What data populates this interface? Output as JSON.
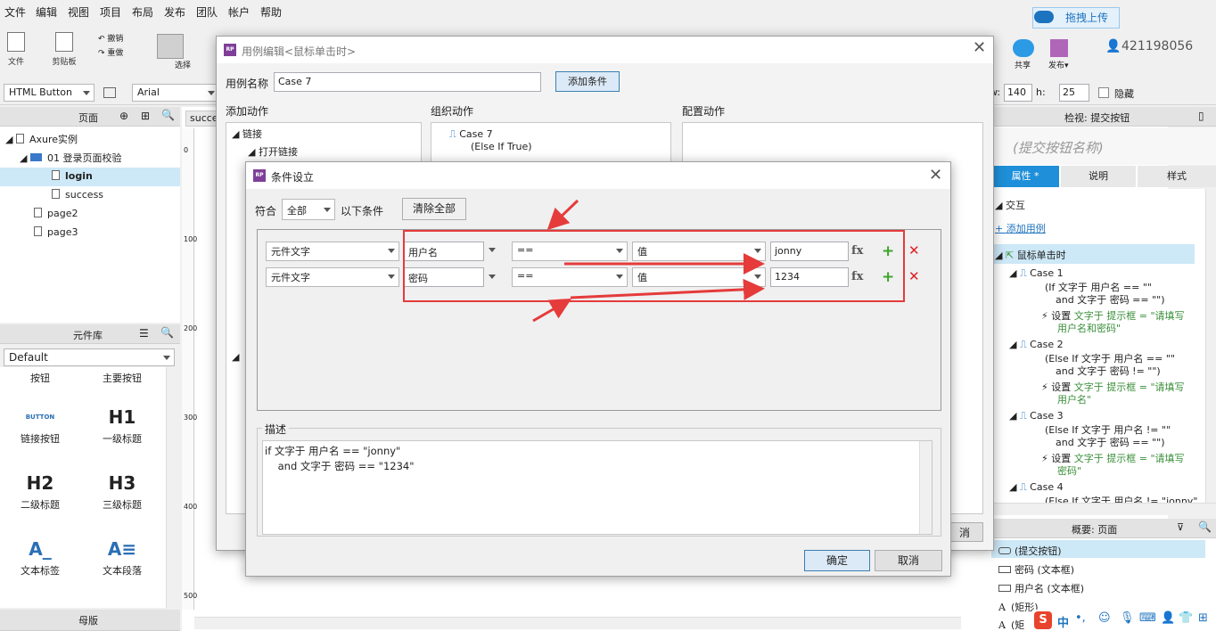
{
  "menu": [
    "文件",
    "编辑",
    "视图",
    "项目",
    "布局",
    "发布",
    "团队",
    "帐户",
    "帮助"
  ],
  "toolbar": {
    "file": "文件",
    "clipboard": "剪贴板",
    "undo": "撤销",
    "redo": "重做",
    "select": "选择",
    "share": "共享",
    "publish": "发布▾",
    "upload": "拖拽上传",
    "user": "421198056"
  },
  "format": {
    "widget_type": "HTML Button",
    "font": "Arial",
    "w_label": "w:",
    "w": "140",
    "h_label": "h:",
    "h": "25",
    "hidden": "隐藏"
  },
  "pages_panel": {
    "title": "页面",
    "root": "Axure实例",
    "folder": "01 登录页面校验",
    "items": [
      "login",
      "success",
      "page2",
      "page3"
    ]
  },
  "library_panel": {
    "title": "元件库",
    "selected": "Default",
    "items": [
      {
        "icon": "",
        "label": "按钮"
      },
      {
        "icon": "",
        "label": "主要按钮"
      },
      {
        "icon": "BUTTON",
        "label": "链接按钮"
      },
      {
        "icon": "H1",
        "label": "一级标题"
      },
      {
        "icon": "H2",
        "label": "二级标题"
      },
      {
        "icon": "H3",
        "label": "三级标题"
      },
      {
        "icon": "A_",
        "label": "文本标签"
      },
      {
        "icon": "A≡",
        "label": "文本段落"
      }
    ]
  },
  "masters_panel": {
    "title": "母版"
  },
  "canvas": {
    "tab": "succe",
    "ruler": [
      "0",
      "100",
      "200",
      "300",
      "400",
      "500"
    ]
  },
  "case_editor": {
    "title": "用例编辑<鼠标单击时>",
    "name_label": "用例名称",
    "name_value": "Case 7",
    "add_condition": "添加条件",
    "col_add": "添加动作",
    "col_org": "组织动作",
    "col_config": "配置动作",
    "actions": [
      "链接",
      "打开链接"
    ],
    "case_name": "Case 7",
    "case_sub": "(Else If True)",
    "cancel_partial": "消"
  },
  "condition_dialog": {
    "title": "条件设立",
    "match_label": "符合",
    "match_value": "全部",
    "match_suffix": "以下条件",
    "clear_all": "清除全部",
    "rows": [
      {
        "type": "元件文字",
        "target": "用户名",
        "op": "==",
        "vtype": "值",
        "value": "jonny"
      },
      {
        "type": "元件文字",
        "target": "密码",
        "op": "==",
        "vtype": "值",
        "value": "1234"
      }
    ],
    "fx": "fx",
    "plus": "+",
    "del": "✕",
    "desc_label": "描述",
    "desc_line1": "if 文字于 用户名 == \"jonny\"",
    "desc_line2": "    and 文字于 密码 == \"1234\"",
    "ok": "确定",
    "cancel": "取消"
  },
  "inspector": {
    "title": "检视: 提交按钮",
    "widget_name": "(提交按钮名称)",
    "tabs": [
      "属性",
      "说明",
      "样式"
    ],
    "interaction": "交互",
    "add_case": "添加用例",
    "event": "鼠标单击时",
    "cases": [
      {
        "name": "Case 1",
        "cond1": "(If 文字于 用户名 == \"\"",
        "cond2": "and 文字于 密码 == \"\")",
        "act": "设置",
        "act_green1": "文字于 提示框 = \"请填写",
        "act_green2": "用户名和密码\""
      },
      {
        "name": "Case 2",
        "cond1": "(Else If 文字于 用户名 == \"\"",
        "cond2": "and 文字于 密码 != \"\")",
        "act": "设置",
        "act_green1": "文字于 提示框 = \"请填写",
        "act_green2": "用户名\""
      },
      {
        "name": "Case 3",
        "cond1": "(Else If 文字于 用户名 != \"\"",
        "cond2": "and 文字于 密码 == \"\")",
        "act": "设置",
        "act_green1": "文字于 提示框 = \"请填写",
        "act_green2": "密码\""
      },
      {
        "name": "Case 4",
        "cond1": "(Else If 文字于 用户名 != \"jonny\""
      }
    ]
  },
  "outline": {
    "title": "概要: 页面",
    "items": [
      "(提交按钮)",
      "密码 (文本框)",
      "用户名 (文本框)",
      "(矩形)",
      "(矩"
    ]
  },
  "ime": {
    "label": "中"
  },
  "colors": {
    "accent": "#e53b3b",
    "purple": "#7f3f98",
    "green": "#3fa32c",
    "blue": "#3a78c9"
  }
}
